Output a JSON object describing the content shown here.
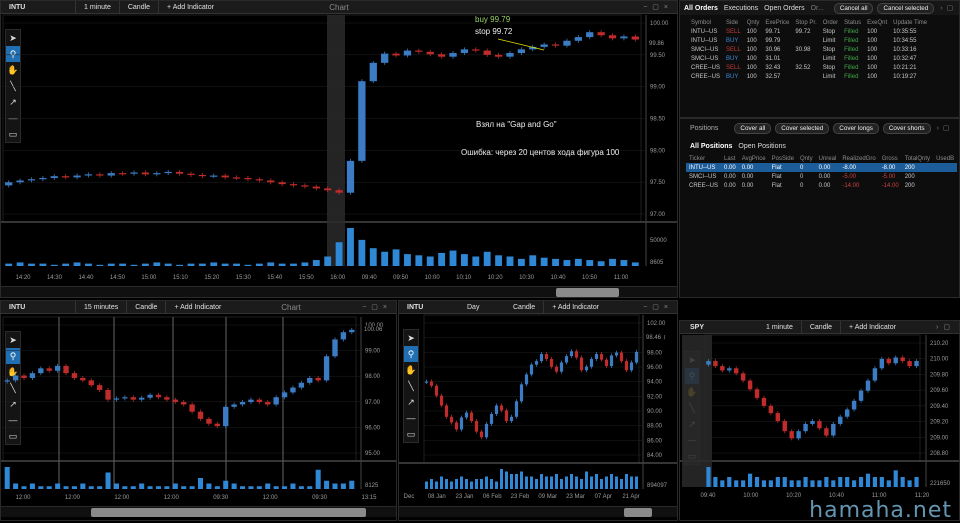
{
  "colors": {
    "up": "#3b7cc4",
    "down": "#c02b2b",
    "vol": "#2f88d6",
    "grid": "#222"
  },
  "main": {
    "symbol": "INTU",
    "interval": "1 minute",
    "style": "Candle",
    "add_indicator": "+ Add Indicator",
    "title": "Chart",
    "price_ticks": [
      "100.00",
      "99.50",
      "99.00",
      "98.50",
      "98.00",
      "97.50",
      "97.00"
    ],
    "last_price": "99.86",
    "vol_tick": "50000",
    "vol_last": "8605",
    "time_ticks": [
      "14:20",
      "14:30",
      "14:40",
      "14:50",
      "15:00",
      "15:10",
      "15:20",
      "15:30",
      "15:40",
      "15:50",
      "16:00",
      "09:40",
      "09:50",
      "10:00",
      "10:10",
      "10:20",
      "10:30",
      "10:40",
      "10:50",
      "11:00"
    ],
    "annot_buy": "buy 99.79",
    "annot_stop": "stop 99.72",
    "note1": "Взял на \"Gap and Go\"",
    "note2": "Ошибка:  через 20 центов хода фигура 100",
    "prices": [
      97.55,
      97.58,
      97.6,
      97.62,
      97.65,
      97.63,
      97.66,
      97.68,
      97.66,
      97.7,
      97.69,
      97.71,
      97.68,
      97.7,
      97.72,
      97.69,
      97.67,
      97.65,
      97.66,
      97.63,
      97.62,
      97.6,
      97.58,
      97.55,
      97.52,
      97.5,
      97.48,
      97.45,
      97.42,
      97.38,
      97.9,
      99.2,
      99.5,
      99.65,
      99.62,
      99.7,
      99.68,
      99.64,
      99.6,
      99.66,
      99.72,
      99.7,
      99.63,
      99.6,
      99.66,
      99.72,
      99.76,
      99.8,
      99.78,
      99.86,
      99.92,
      100.0,
      99.95,
      99.9,
      99.93,
      99.88
    ],
    "vols": [
      2,
      3,
      2,
      2,
      1,
      2,
      3,
      2,
      1,
      2,
      2,
      1,
      2,
      3,
      2,
      1,
      2,
      2,
      3,
      2,
      2,
      1,
      2,
      3,
      2,
      2,
      3,
      5,
      8,
      20,
      32,
      22,
      15,
      12,
      14,
      10,
      9,
      8,
      11,
      13,
      10,
      8,
      12,
      9,
      8,
      6,
      9,
      7,
      6,
      5,
      6,
      5,
      4,
      6,
      5,
      3
    ]
  },
  "c15": {
    "symbol": "INTU",
    "interval": "15 minutes",
    "style": "Candle",
    "add_indicator": "+ Add Indicator",
    "title": "Chart",
    "price_ticks": [
      "100.00",
      "99.00",
      "98.00",
      "97.00",
      "96.00",
      "95.00"
    ],
    "last_price": "100.06",
    "vol_last": "8125",
    "time_ticks": [
      "12:00",
      "12:00",
      "12:00",
      "12:00",
      "09:30",
      "12:00",
      "09:30",
      "13:15"
    ],
    "prices": [
      98.0,
      98.2,
      98.1,
      98.3,
      98.5,
      98.4,
      98.6,
      98.3,
      98.1,
      98.0,
      97.8,
      97.6,
      97.2,
      97.25,
      97.3,
      97.2,
      97.28,
      97.4,
      97.3,
      97.2,
      97.1,
      97.0,
      96.7,
      96.4,
      96.2,
      96.1,
      96.9,
      97.0,
      97.1,
      97.2,
      97.1,
      97.0,
      97.3,
      97.5,
      97.7,
      97.9,
      98.1,
      98.0,
      99.0,
      99.7,
      100.0,
      100.1
    ],
    "vols": [
      8,
      2,
      1,
      2,
      1,
      1,
      2,
      1,
      1,
      2,
      1,
      1,
      6,
      2,
      1,
      1,
      2,
      1,
      1,
      1,
      2,
      1,
      1,
      4,
      2,
      1,
      3,
      2,
      1,
      1,
      1,
      2,
      1,
      1,
      2,
      1,
      1,
      7,
      3,
      2,
      2,
      3
    ]
  },
  "day": {
    "symbol": "INTU",
    "interval": "Day",
    "style": "Candle",
    "add_indicator": "+ Add Indicator",
    "price_ticks": [
      "102.00",
      "100.00",
      "98.00",
      "96.00",
      "94.00",
      "92.00",
      "90.00",
      "88.00",
      "86.00",
      "84.00"
    ],
    "last_price": "98.46",
    "vol_last": "894097",
    "time_ticks": [
      "Dec",
      "08 Jan",
      "23 Jan",
      "06 Feb",
      "23 Feb",
      "09 Mar",
      "23 Mar",
      "07 Apr",
      "21 Apr"
    ],
    "prices": [
      94.2,
      93.6,
      92.2,
      90.8,
      89.2,
      88.4,
      87.4,
      89.1,
      89.8,
      88.6,
      87.1,
      86.3,
      88.2,
      89.6,
      90.8,
      90.1,
      88.6,
      89.2,
      91.4,
      93.8,
      95.2,
      96.6,
      97.1,
      98.1,
      97.4,
      96.3,
      95.6,
      96.9,
      97.8,
      98.5,
      97.6,
      95.8,
      96.3,
      97.4,
      98.1,
      97.3,
      96.4,
      97.9,
      98.3,
      97.1,
      95.8,
      96.9,
      98.4
    ],
    "vols": [
      3,
      4,
      3,
      5,
      4,
      3,
      4,
      5,
      4,
      3,
      4,
      4,
      5,
      4,
      3,
      8,
      7,
      6,
      6,
      7,
      5,
      5,
      4,
      6,
      5,
      5,
      6,
      4,
      5,
      6,
      5,
      4,
      7,
      5,
      6,
      4,
      5,
      6,
      5,
      4,
      6,
      5,
      5
    ]
  },
  "spy": {
    "symbol": "SPY",
    "interval": "1 minute",
    "style": "Candle",
    "add_indicator": "+ Add Indicator",
    "price_ticks": [
      "210.20",
      "210.00",
      "209.80",
      "209.60",
      "209.40",
      "209.20",
      "209.00",
      "208.80"
    ],
    "vol_last": "221650",
    "time_ticks": [
      "09:40",
      "10:00",
      "10:20",
      "10:40",
      "11:00",
      "11:20"
    ],
    "prices": [
      210.05,
      209.98,
      209.92,
      209.95,
      209.88,
      209.78,
      209.66,
      209.54,
      209.43,
      209.33,
      209.22,
      209.08,
      208.98,
      209.08,
      209.18,
      209.22,
      209.12,
      209.02,
      209.18,
      209.28,
      209.38,
      209.5,
      209.64,
      209.78,
      209.95,
      210.08,
      210.02,
      210.1,
      210.05,
      209.98,
      210.05
    ],
    "vols": [
      6,
      3,
      2,
      3,
      2,
      2,
      4,
      3,
      2,
      2,
      3,
      3,
      2,
      2,
      3,
      2,
      2,
      3,
      2,
      3,
      3,
      2,
      3,
      4,
      3,
      3,
      2,
      5,
      3,
      2,
      3
    ]
  },
  "orders": {
    "tabs": [
      "All Orders",
      "Executions",
      "Open Orders",
      "Or..."
    ],
    "cancel_all": "Cancel all",
    "cancel_selected": "Cancel selected",
    "cols": [
      "Symbol",
      "Side",
      "Qnty",
      "ExePrice",
      "Stop Pr.",
      "Order",
      "Status",
      "ExeQnt",
      "Update Time"
    ],
    "rows": [
      [
        "INTU--US",
        "SELL",
        "100",
        "99.71",
        "99.72",
        "Stop",
        "Filled",
        "100",
        "10:35:55"
      ],
      [
        "INTU--US",
        "BUY",
        "100",
        "99.79",
        "",
        "Limit",
        "Filled",
        "100",
        "10:34:55"
      ],
      [
        "SMCI--US",
        "SELL",
        "100",
        "30.96",
        "30.98",
        "Stop",
        "Filled",
        "100",
        "10:33:16"
      ],
      [
        "SMCI--US",
        "BUY",
        "100",
        "31.01",
        "",
        "Limit",
        "Filled",
        "100",
        "10:32:47"
      ],
      [
        "CREE--US",
        "SELL",
        "100",
        "32.43",
        "32.52",
        "Stop",
        "Filled",
        "100",
        "10:21:21"
      ],
      [
        "CREE--US",
        "BUY",
        "100",
        "32.57",
        "",
        "Limit",
        "Filled",
        "100",
        "10:19:27"
      ]
    ]
  },
  "positions": {
    "title": "Positions",
    "buttons": [
      "Cover all",
      "Cover selected",
      "Cover longs",
      "Cover shorts"
    ],
    "tabs": [
      "All Positions",
      "Open Positions"
    ],
    "cols": [
      "Ticker",
      "Last",
      "AvgPrice",
      "PosSide",
      "Qnty",
      "Unreal",
      "RealizedGro",
      "Gross",
      "TotalQnty",
      "UsedB"
    ],
    "rows": [
      [
        "INTU--US",
        "0.00",
        "0.00",
        "Flat",
        "0",
        "0.00",
        "-8.00",
        "-8.00",
        "200",
        ""
      ],
      [
        "SMCI--US",
        "0.00",
        "0.00",
        "Flat",
        "0",
        "0.00",
        "-5.00",
        "-5.00",
        "200",
        ""
      ],
      [
        "CREE--US",
        "0.00",
        "0.00",
        "Flat",
        "0",
        "0.00",
        "-14.00",
        "-14.00",
        "200",
        ""
      ]
    ]
  },
  "watermark": "hamaha.net"
}
